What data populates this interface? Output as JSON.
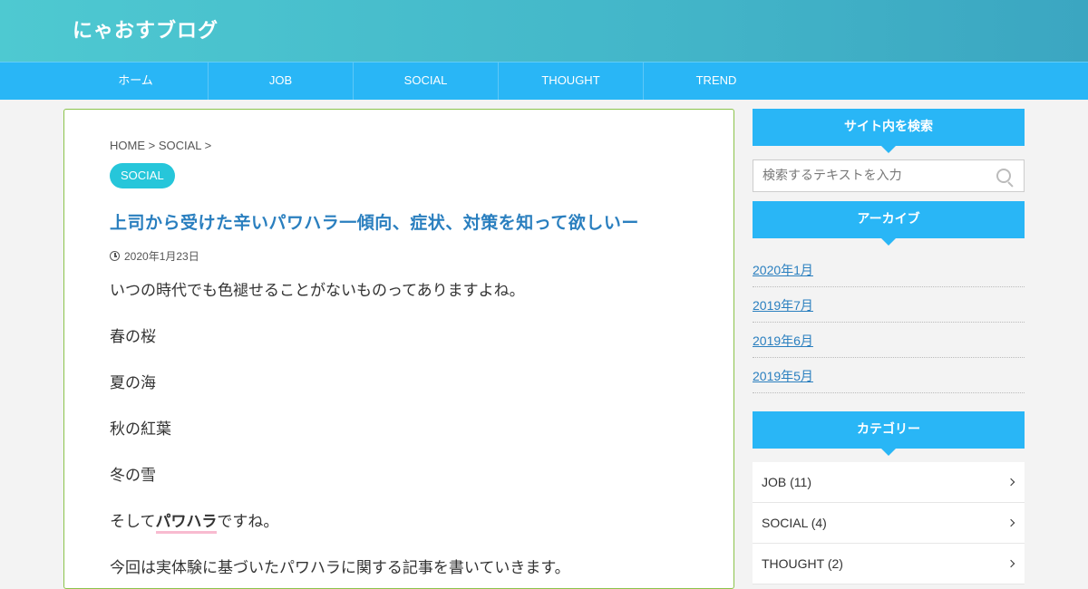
{
  "site": {
    "title": "にゃおすブログ"
  },
  "nav": {
    "items": [
      "ホーム",
      "JOB",
      "SOCIAL",
      "THOUGHT",
      "TREND"
    ]
  },
  "breadcrumb": {
    "home": "HOME",
    "sep1": " > ",
    "category": "SOCIAL",
    "sep2": " >"
  },
  "post": {
    "category": "SOCIAL",
    "title": "上司から受けた辛いパワハラ一傾向、症状、対策を知って欲しいー",
    "date": "2020年1月23日",
    "paragraphs": [
      "いつの時代でも色褪せることがないものってありますよね。",
      "春の桜",
      "夏の海",
      "秋の紅葉",
      "冬の雪"
    ],
    "p6_before": "そして",
    "p6_emph": "パワハラ",
    "p6_after": "ですね。",
    "p7": "今回は実体験に基づいたパワハラに関する記事を書いていきます。"
  },
  "sidebar": {
    "search": {
      "heading": "サイト内を検索",
      "placeholder": "検索するテキストを入力"
    },
    "archive": {
      "heading": "アーカイブ",
      "items": [
        "2020年1月",
        "2019年7月",
        "2019年6月",
        "2019年5月"
      ]
    },
    "categories": {
      "heading": "カテゴリー",
      "items": [
        "JOB (11)",
        "SOCIAL (4)",
        "THOUGHT (2)"
      ]
    }
  },
  "colors": {
    "accent": "#29b6f6",
    "badge": "#26c6da",
    "title": "#2a7fbf",
    "frame": "#8bc34a"
  }
}
